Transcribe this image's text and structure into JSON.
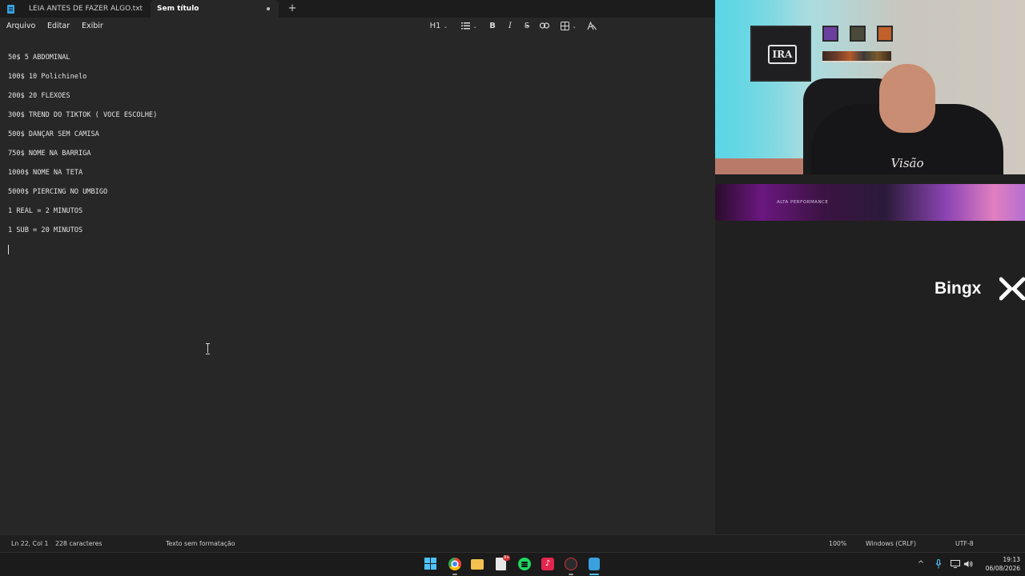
{
  "tabs": [
    {
      "label": "LEIA ANTES DE FAZER ALGO.txt",
      "active": false
    },
    {
      "label": "Sem título",
      "active": true
    }
  ],
  "new_tab_label": "+",
  "menu": {
    "file": "Arquivo",
    "edit": "Editar",
    "view": "Exibir"
  },
  "toolbar": {
    "heading": "H1",
    "list_icon": "list-icon",
    "bold": "B",
    "italic": "I",
    "strike": "S",
    "link_icon": "link-icon",
    "table_icon": "table-icon",
    "clear_format_icon": "clear-format-icon"
  },
  "document": {
    "lines": [
      "50$ 5 ABDOMINAL",
      "100$ 10 Polichinelo",
      "200$ 20 FLEXOES",
      "300$ TREND DO TIKTOK ( VOCE ESCOLHE)",
      "500$ DANÇAR SEM CAMISA",
      "750$ NOME NA BARRIGA",
      "1000$ NOME NA TETA",
      "5000$ PIERCING NO UMBIGO",
      "1 REAL = 2 MINUTOS",
      "1 SUB = 20 MINUTOS"
    ]
  },
  "overlay": {
    "poster_text": "IRA",
    "shirt_text": "Visão",
    "banner_text": "ALTA PERFORMANCE",
    "sponsor": "BingX",
    "sponsor_name_part": "Bing",
    "sponsor_x_part": "x"
  },
  "status": {
    "position": "Ln 22, Col 1",
    "chars": "228 caracteres",
    "format": "Texto sem formatação",
    "zoom": "100%",
    "line_ending": "Windows (CRLF)",
    "encoding": "UTF-8"
  },
  "taskbar": {
    "apps": [
      "start-icon",
      "chrome-icon",
      "file-explorer-icon",
      "files-icon",
      "spotify-icon",
      "tiktok-icon",
      "app-icon",
      "notepad-icon"
    ],
    "files_badge": "9+",
    "tray": {
      "chevron": "^",
      "mic_icon": "microphone-icon",
      "network_icon": "network-icon",
      "volume_icon": "volume-icon"
    },
    "time": "19:13",
    "date": "06/08/2026"
  },
  "colors": {
    "accent": "#4cc2ff",
    "editor_bg": "#272727",
    "tab_bar_bg": "#1c1c1c"
  }
}
